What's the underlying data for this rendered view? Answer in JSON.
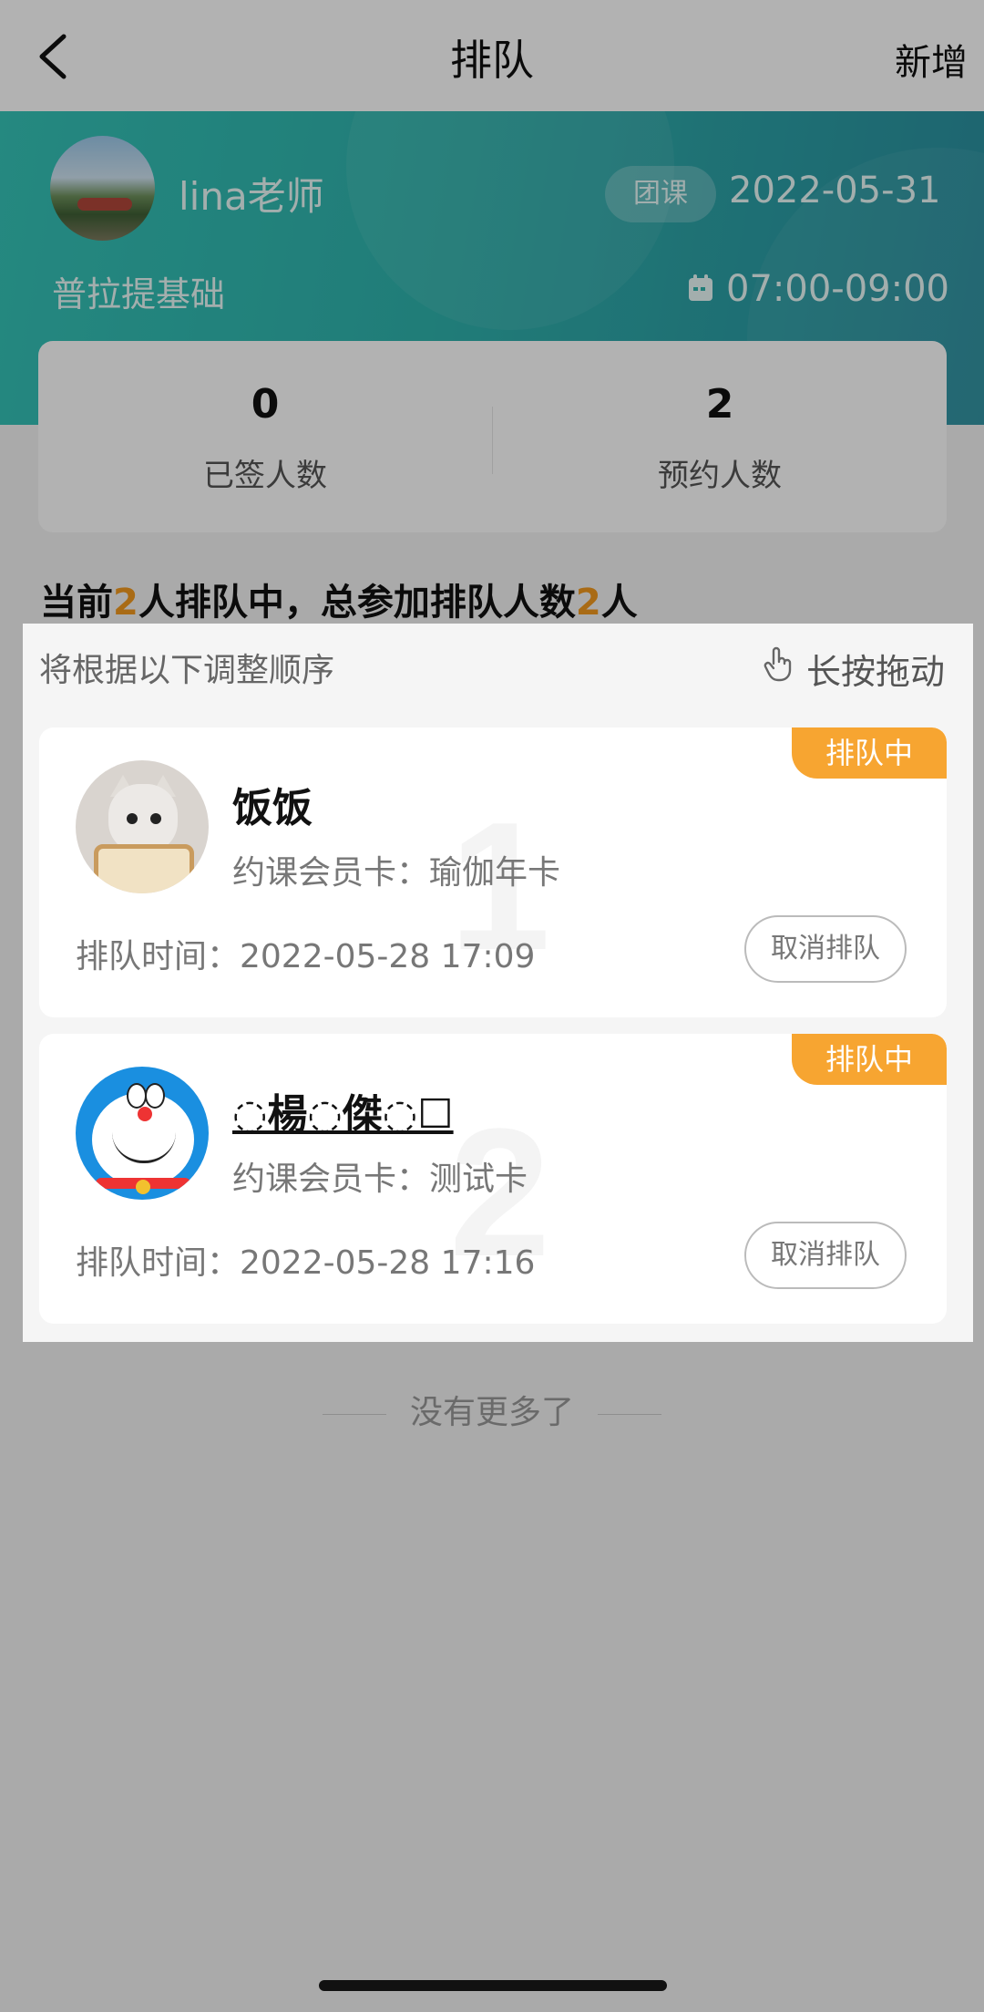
{
  "navbar": {
    "title": "排队",
    "back_icon": "chevron-left-icon",
    "add_label": "新增"
  },
  "class_info": {
    "teacher_name": "lina老师",
    "badge": "团课",
    "date": "2022-05-31",
    "course_name": "普拉提基础",
    "time_icon": "calendar-icon",
    "time": "07:00-09:00",
    "theme_color": "#2fb3ad"
  },
  "stats": {
    "signed_value": "0",
    "signed_label": "已签人数",
    "booked_value": "2",
    "booked_label": "预约人数"
  },
  "summary": {
    "prefix": "当前",
    "queuing_count": "2",
    "middle": "人排队中，总参加排队人数",
    "total_count": "2",
    "suffix": "人",
    "accent_color": "#f39a1f"
  },
  "list": {
    "hint": "将根据以下调整顺序",
    "drag_icon": "hand-pointer-icon",
    "drag_label": "长按拖动",
    "queue": [
      {
        "order": "1",
        "status": "排队中",
        "name": "饭饭",
        "member_card": "约课会员卡：瑜伽年卡",
        "queue_time": "排队时间：2022-05-28 17:09",
        "cancel_label": "取消排队",
        "avatar_icon": "cat-avatar"
      },
      {
        "order": "2",
        "status": "排队中",
        "name": "◌楊◌傑◌☐",
        "member_card": "约课会员卡：测试卡",
        "queue_time": "排队时间：2022-05-28 17:16",
        "cancel_label": "取消排队",
        "avatar_icon": "doraemon-avatar"
      }
    ],
    "no_more": "没有更多了"
  }
}
